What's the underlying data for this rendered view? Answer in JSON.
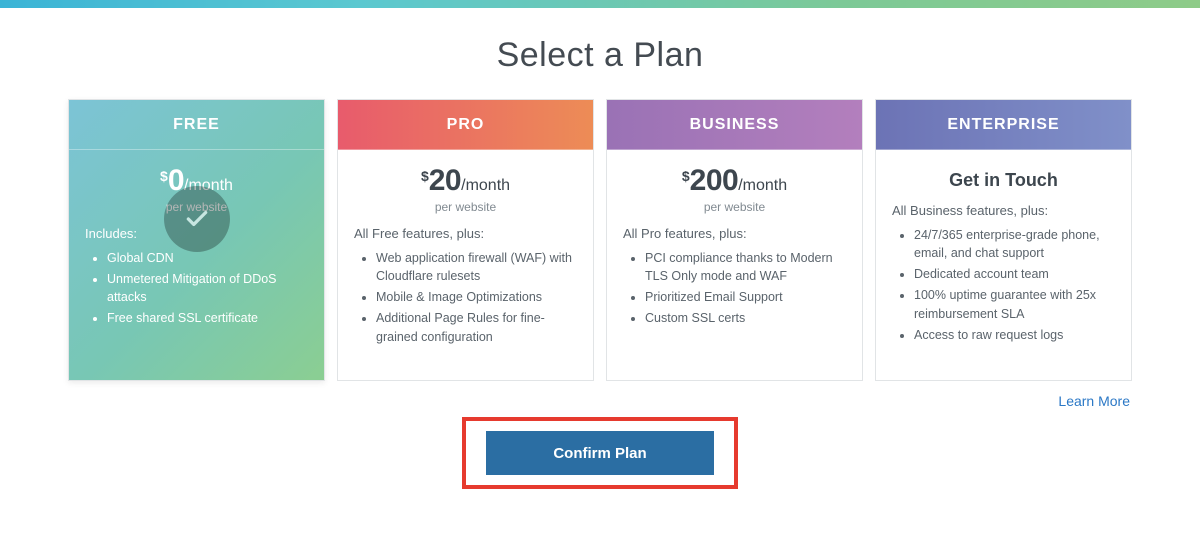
{
  "page_title": "Select a Plan",
  "learn_more_label": "Learn More",
  "confirm_label": "Confirm Plan",
  "plans": {
    "free": {
      "name": "FREE",
      "price": "0",
      "per": "/month",
      "per_website": "per website",
      "lead": "Includes:",
      "features": [
        "Global CDN",
        "Unmetered Mitigation of DDoS attacks",
        "Free shared SSL certificate"
      ]
    },
    "pro": {
      "name": "PRO",
      "price": "20",
      "per": "/month",
      "per_website": "per website",
      "lead": "All Free features, plus:",
      "features": [
        "Web application firewall (WAF) with Cloudflare rulesets",
        "Mobile & Image Optimizations",
        "Additional Page Rules for fine-grained configuration"
      ]
    },
    "business": {
      "name": "BUSINESS",
      "price": "200",
      "per": "/month",
      "per_website": "per website",
      "lead": "All Pro features, plus:",
      "features": [
        "PCI compliance thanks to Modern TLS Only mode and WAF",
        "Prioritized Email Support",
        "Custom SSL certs"
      ]
    },
    "enterprise": {
      "name": "ENTERPRISE",
      "get_in_touch": "Get in Touch",
      "lead": "All Business features, plus:",
      "features": [
        "24/7/365 enterprise-grade phone, email, and chat support",
        "Dedicated account team",
        "100% uptime guarantee with 25x reimbursement SLA",
        "Access to raw request logs"
      ]
    }
  }
}
